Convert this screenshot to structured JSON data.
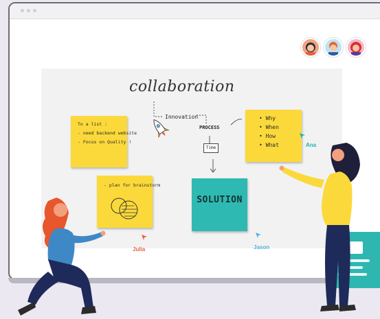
{
  "board": {
    "title": "collaboration",
    "innovation_label": "Innovation",
    "process_label": "PROCESS",
    "time_label": "Time"
  },
  "notes": {
    "todo": [
      "To a list :",
      "- need backend website",
      "- Focus on Quality !"
    ],
    "plan": [
      "- plan for brainstorm"
    ],
    "questions": [
      "• Why",
      "• When",
      "• How",
      "• What"
    ]
  },
  "solution": {
    "label": "SOLUTION"
  },
  "collaborators": [
    {
      "name": "Ana",
      "color": "#20b3ad"
    },
    {
      "name": "Julia",
      "color": "#e9623a"
    },
    {
      "name": "Jason",
      "color": "#4fb3de"
    }
  ],
  "colors": {
    "sticky": "#fbd93a",
    "solution": "#2fb9b3",
    "frame": "#6f6c75",
    "background": "#ece8f1"
  },
  "avatars": [
    "avatar-woman-dark-hair",
    "avatar-man-orange-hair",
    "avatar-woman-red-hair"
  ]
}
